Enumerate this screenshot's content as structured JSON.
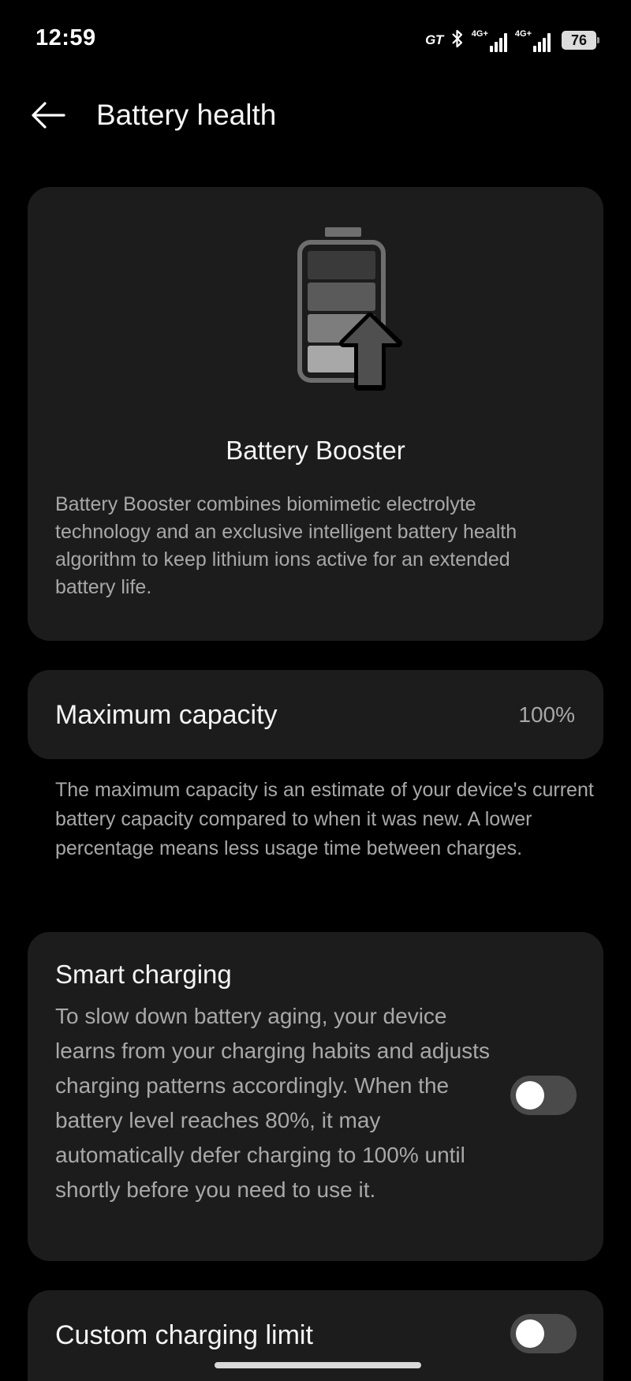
{
  "status_bar": {
    "time": "12:59",
    "carrier_badge": "GT",
    "network_1": "4G+",
    "network_2": "4G+",
    "battery_level": "76"
  },
  "header": {
    "title": "Battery health",
    "back_icon": "arrow-left-icon"
  },
  "booster": {
    "icon": "battery-upgrade-icon",
    "title": "Battery Booster",
    "description": "Battery Booster combines biomimetic electrolyte technology and an exclusive intelligent battery health algorithm to keep lithium ions active for an extended battery life."
  },
  "capacity": {
    "label": "Maximum capacity",
    "value": "100%",
    "note": "The maximum capacity is an estimate of your device's current battery capacity compared to when it was new. A lower percentage means less usage time between charges."
  },
  "smart_charging": {
    "title": "Smart charging",
    "description": "To slow down battery aging, your device learns from your charging habits and adjusts charging patterns accordingly. When the battery level reaches 80%, it may automatically defer charging to 100% until shortly before you need to use it.",
    "enabled": false
  },
  "custom_limit": {
    "title": "Custom charging limit",
    "enabled": false
  },
  "colors": {
    "background": "#000000",
    "card": "#1c1c1c",
    "secondary_text": "#a8a8a8",
    "toggle_off_track": "#4a4a4a"
  }
}
